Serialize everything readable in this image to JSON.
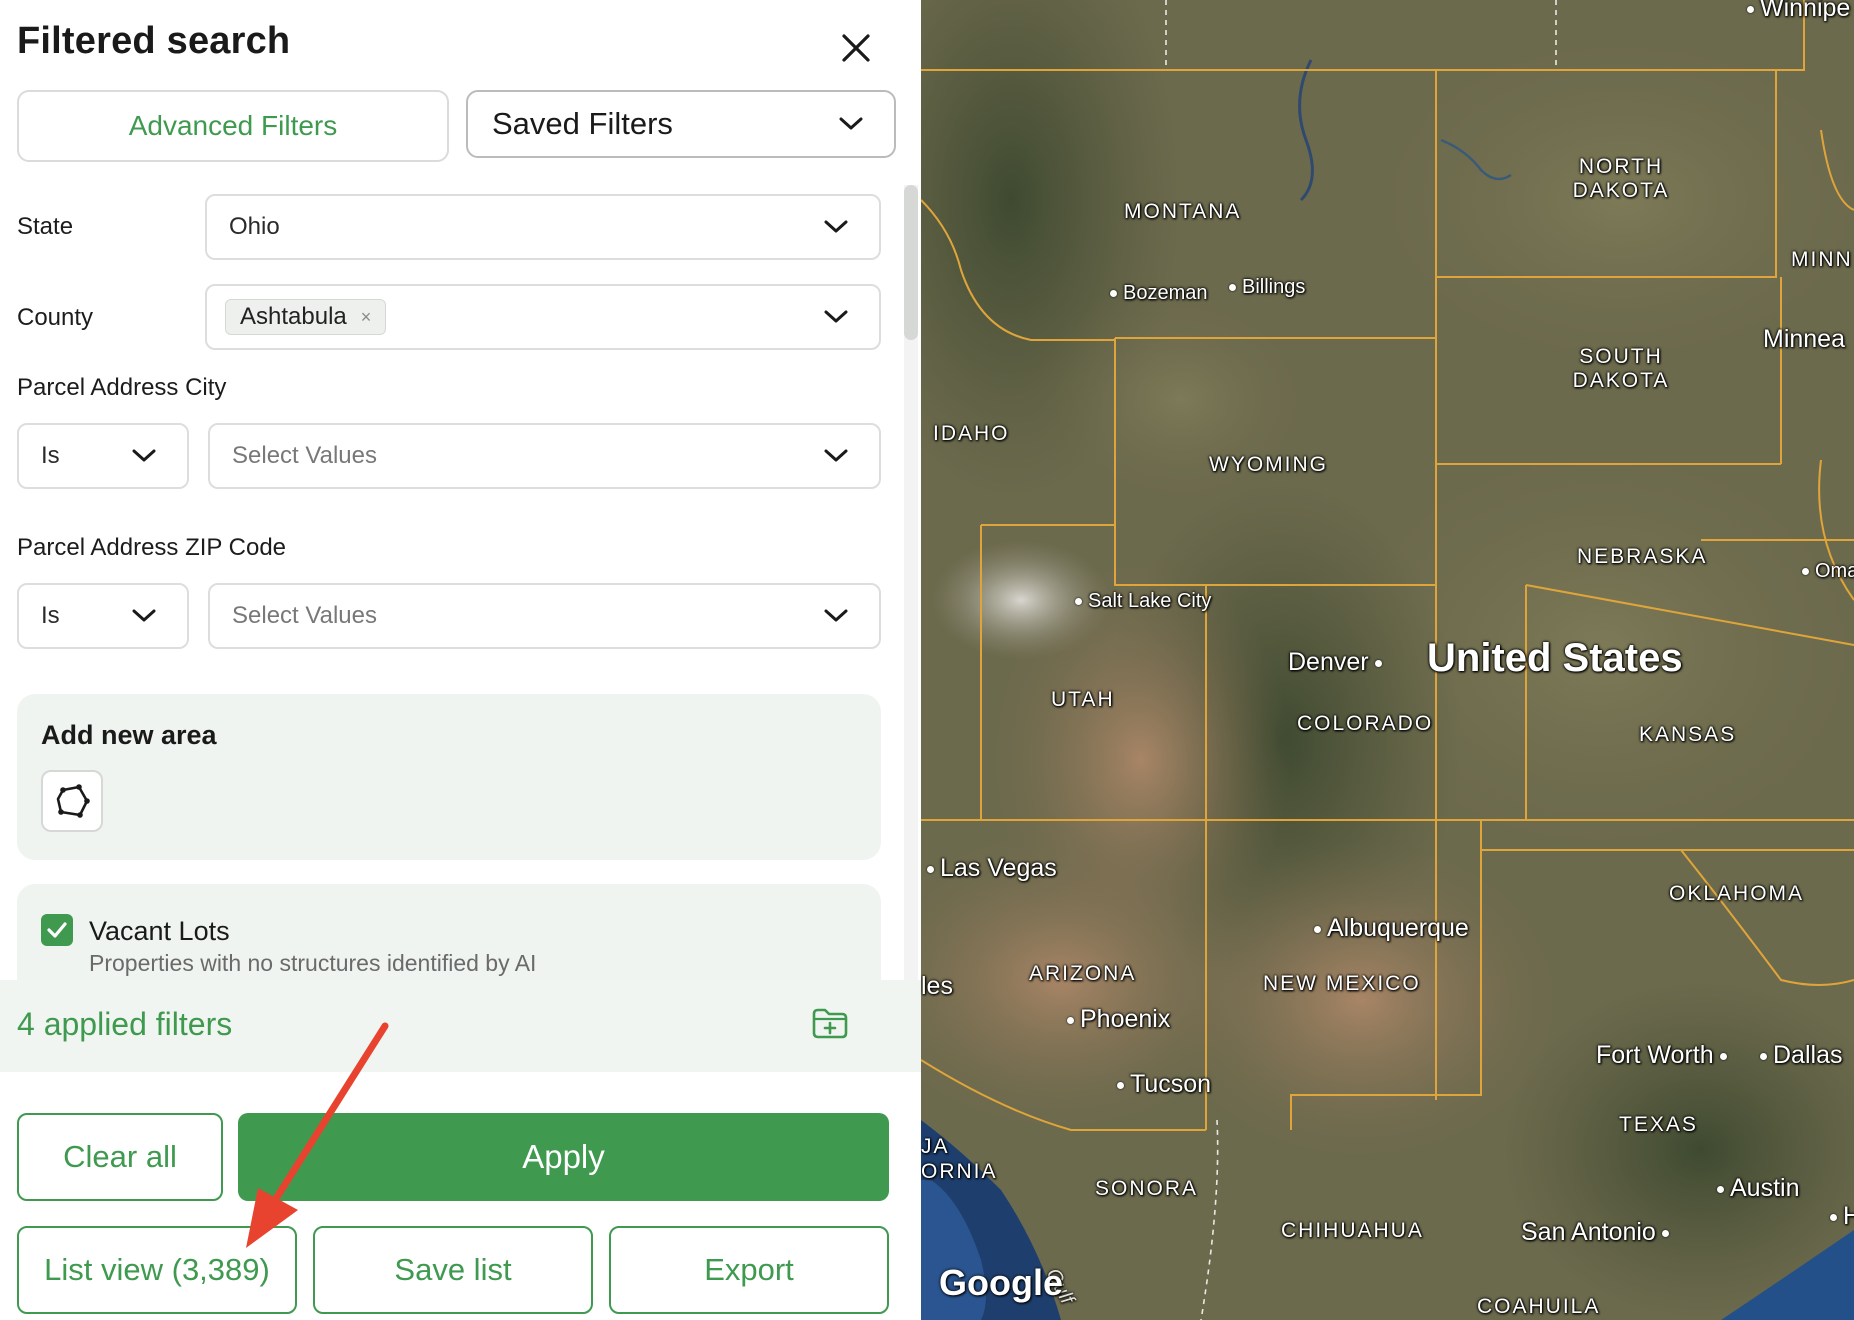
{
  "panel": {
    "title": "Filtered search",
    "advanced_filters": "Advanced Filters",
    "saved_filters": "Saved Filters",
    "state": {
      "label": "State",
      "value": "Ohio"
    },
    "county": {
      "label": "County",
      "chip": "Ashtabula",
      "chip_remove": "×"
    },
    "city": {
      "label": "Parcel Address City",
      "operator": "Is",
      "placeholder": "Select Values"
    },
    "zip": {
      "label": "Parcel Address ZIP Code",
      "operator": "Is",
      "placeholder": "Select Values"
    },
    "area": {
      "title": "Add new area"
    },
    "vacant": {
      "title": "Vacant Lots",
      "subtitle": "Properties with no structures identified by AI",
      "checked": true
    },
    "applied": "4 applied filters",
    "buttons": {
      "clear_all": "Clear all",
      "apply": "Apply",
      "list_view": "List view (3,389)",
      "save_list": "Save list",
      "export": "Export"
    }
  },
  "colors": {
    "accent": "#3f9a50",
    "border_line": "#e0a53a",
    "arrow": "#e8432f"
  },
  "map": {
    "country": "United States",
    "states": [
      "MONTANA",
      "NORTH DAKOTA",
      "SOUTH DAKOTA",
      "MINN",
      "IDAHO",
      "WYOMING",
      "NEBRASKA",
      "UTAH",
      "COLORADO",
      "KANSAS",
      "OKLAHOMA",
      "ARIZONA",
      "NEW MEXICO",
      "TEXAS",
      "SONORA",
      "CHIHUAHUA",
      "COAHUILA",
      "JA",
      "ORNIA"
    ],
    "cities": {
      "winnipeg": "Winnipe",
      "bozeman": "Bozeman",
      "billings": "Billings",
      "minneapolis": "Minnea",
      "salt_lake": "Salt Lake City",
      "denver": "Denver",
      "omaha": "Oma",
      "las_vegas": "Las Vegas",
      "albuquerque": "Albuquerque",
      "los_angeles": "les",
      "phoenix": "Phoenix",
      "tucson": "Tucson",
      "fort_worth": "Fort Worth",
      "dallas": "Dallas",
      "austin": "Austin",
      "houston": "H",
      "san_antonio": "San Antonio"
    },
    "attribution": "Google",
    "gulf": "Gulf"
  }
}
